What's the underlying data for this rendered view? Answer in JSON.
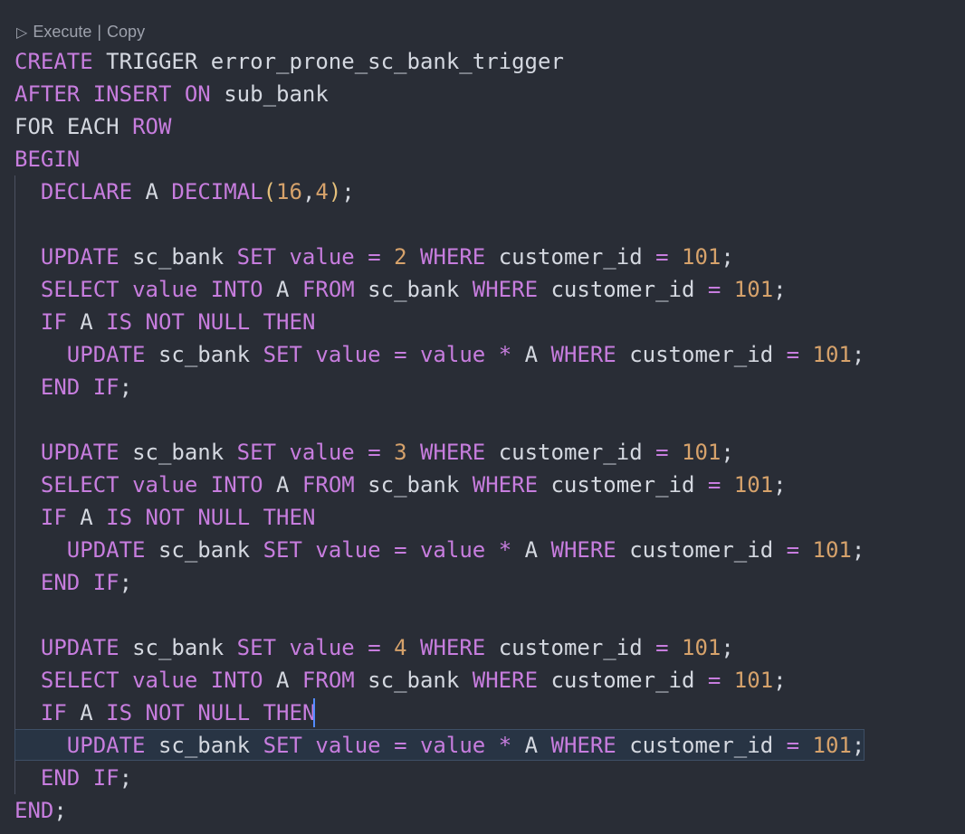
{
  "codelens": {
    "icon": "play-icon",
    "execute_label": "Execute",
    "separator": "|",
    "copy_label": "Copy"
  },
  "colors": {
    "background": "#292d36",
    "keyword": "#c77dde",
    "number": "#d6a26b",
    "identifier": "#d4d8e0",
    "selection": "#283444",
    "cursor": "#528bff"
  },
  "code_lines": [
    "CREATE TRIGGER error_prone_sc_bank_trigger",
    "AFTER INSERT ON sub_bank",
    "FOR EACH ROW",
    "BEGIN",
    "  DECLARE A DECIMAL(16,4);",
    "",
    "  UPDATE sc_bank SET value = 2 WHERE customer_id = 101;",
    "  SELECT value INTO A FROM sc_bank WHERE customer_id = 101;",
    "  IF A IS NOT NULL THEN",
    "    UPDATE sc_bank SET value = value * A WHERE customer_id = 101;",
    "  END IF;",
    "",
    "  UPDATE sc_bank SET value = 3 WHERE customer_id = 101;",
    "  SELECT value INTO A FROM sc_bank WHERE customer_id = 101;",
    "  IF A IS NOT NULL THEN",
    "    UPDATE sc_bank SET value = value * A WHERE customer_id = 101;",
    "  END IF;",
    "",
    "  UPDATE sc_bank SET value = 4 WHERE customer_id = 101;",
    "  SELECT value INTO A FROM sc_bank WHERE customer_id = 101;",
    "  IF A IS NOT NULL THEN",
    "    UPDATE sc_bank SET value = value * A WHERE customer_id = 101;",
    "  END IF;",
    "END;"
  ]
}
